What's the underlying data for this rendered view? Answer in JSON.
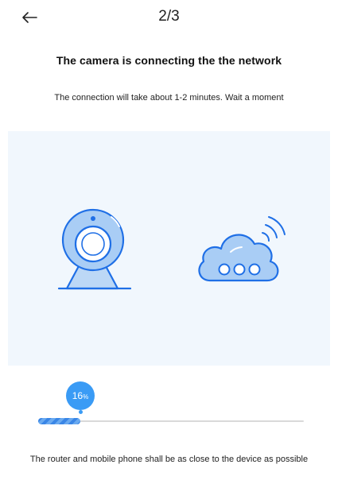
{
  "header": {
    "step": "2/3"
  },
  "main": {
    "title": "The camera is connecting the the network",
    "subtitle": "The connection will take about 1-2 minutes. Wait a moment"
  },
  "progress": {
    "value": 16,
    "number": "16",
    "unit": "%"
  },
  "footer": {
    "note": "The router and mobile phone shall be as close to the device as possible"
  },
  "icons": {
    "back": "arrow-left-icon",
    "camera": "camera-icon",
    "cloud": "cloud-wifi-icon"
  },
  "colors": {
    "accent": "#3a9bf5",
    "illustration_bg": "#f1f7fd",
    "icon_stroke": "#1f6fe6",
    "icon_fill": "#a9cdf5"
  }
}
